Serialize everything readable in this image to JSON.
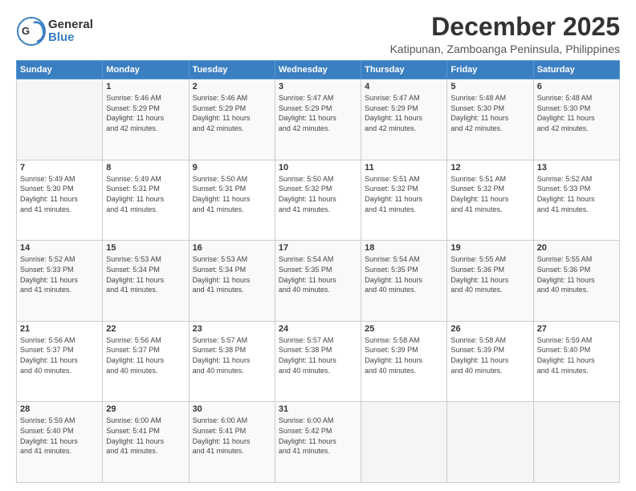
{
  "header": {
    "logo_general": "General",
    "logo_blue": "Blue",
    "title": "December 2025",
    "subtitle": "Katipunan, Zamboanga Peninsula, Philippines"
  },
  "days_of_week": [
    "Sunday",
    "Monday",
    "Tuesday",
    "Wednesday",
    "Thursday",
    "Friday",
    "Saturday"
  ],
  "weeks": [
    [
      {
        "day": "",
        "info": ""
      },
      {
        "day": "1",
        "info": "Sunrise: 5:46 AM\nSunset: 5:29 PM\nDaylight: 11 hours\nand 42 minutes."
      },
      {
        "day": "2",
        "info": "Sunrise: 5:46 AM\nSunset: 5:29 PM\nDaylight: 11 hours\nand 42 minutes."
      },
      {
        "day": "3",
        "info": "Sunrise: 5:47 AM\nSunset: 5:29 PM\nDaylight: 11 hours\nand 42 minutes."
      },
      {
        "day": "4",
        "info": "Sunrise: 5:47 AM\nSunset: 5:29 PM\nDaylight: 11 hours\nand 42 minutes."
      },
      {
        "day": "5",
        "info": "Sunrise: 5:48 AM\nSunset: 5:30 PM\nDaylight: 11 hours\nand 42 minutes."
      },
      {
        "day": "6",
        "info": "Sunrise: 5:48 AM\nSunset: 5:30 PM\nDaylight: 11 hours\nand 42 minutes."
      }
    ],
    [
      {
        "day": "7",
        "info": "Sunrise: 5:49 AM\nSunset: 5:30 PM\nDaylight: 11 hours\nand 41 minutes."
      },
      {
        "day": "8",
        "info": "Sunrise: 5:49 AM\nSunset: 5:31 PM\nDaylight: 11 hours\nand 41 minutes."
      },
      {
        "day": "9",
        "info": "Sunrise: 5:50 AM\nSunset: 5:31 PM\nDaylight: 11 hours\nand 41 minutes."
      },
      {
        "day": "10",
        "info": "Sunrise: 5:50 AM\nSunset: 5:32 PM\nDaylight: 11 hours\nand 41 minutes."
      },
      {
        "day": "11",
        "info": "Sunrise: 5:51 AM\nSunset: 5:32 PM\nDaylight: 11 hours\nand 41 minutes."
      },
      {
        "day": "12",
        "info": "Sunrise: 5:51 AM\nSunset: 5:32 PM\nDaylight: 11 hours\nand 41 minutes."
      },
      {
        "day": "13",
        "info": "Sunrise: 5:52 AM\nSunset: 5:33 PM\nDaylight: 11 hours\nand 41 minutes."
      }
    ],
    [
      {
        "day": "14",
        "info": "Sunrise: 5:52 AM\nSunset: 5:33 PM\nDaylight: 11 hours\nand 41 minutes."
      },
      {
        "day": "15",
        "info": "Sunrise: 5:53 AM\nSunset: 5:34 PM\nDaylight: 11 hours\nand 41 minutes."
      },
      {
        "day": "16",
        "info": "Sunrise: 5:53 AM\nSunset: 5:34 PM\nDaylight: 11 hours\nand 41 minutes."
      },
      {
        "day": "17",
        "info": "Sunrise: 5:54 AM\nSunset: 5:35 PM\nDaylight: 11 hours\nand 40 minutes."
      },
      {
        "day": "18",
        "info": "Sunrise: 5:54 AM\nSunset: 5:35 PM\nDaylight: 11 hours\nand 40 minutes."
      },
      {
        "day": "19",
        "info": "Sunrise: 5:55 AM\nSunset: 5:36 PM\nDaylight: 11 hours\nand 40 minutes."
      },
      {
        "day": "20",
        "info": "Sunrise: 5:55 AM\nSunset: 5:36 PM\nDaylight: 11 hours\nand 40 minutes."
      }
    ],
    [
      {
        "day": "21",
        "info": "Sunrise: 5:56 AM\nSunset: 5:37 PM\nDaylight: 11 hours\nand 40 minutes."
      },
      {
        "day": "22",
        "info": "Sunrise: 5:56 AM\nSunset: 5:37 PM\nDaylight: 11 hours\nand 40 minutes."
      },
      {
        "day": "23",
        "info": "Sunrise: 5:57 AM\nSunset: 5:38 PM\nDaylight: 11 hours\nand 40 minutes."
      },
      {
        "day": "24",
        "info": "Sunrise: 5:57 AM\nSunset: 5:38 PM\nDaylight: 11 hours\nand 40 minutes."
      },
      {
        "day": "25",
        "info": "Sunrise: 5:58 AM\nSunset: 5:39 PM\nDaylight: 11 hours\nand 40 minutes."
      },
      {
        "day": "26",
        "info": "Sunrise: 5:58 AM\nSunset: 5:39 PM\nDaylight: 11 hours\nand 40 minutes."
      },
      {
        "day": "27",
        "info": "Sunrise: 5:59 AM\nSunset: 5:40 PM\nDaylight: 11 hours\nand 41 minutes."
      }
    ],
    [
      {
        "day": "28",
        "info": "Sunrise: 5:59 AM\nSunset: 5:40 PM\nDaylight: 11 hours\nand 41 minutes."
      },
      {
        "day": "29",
        "info": "Sunrise: 6:00 AM\nSunset: 5:41 PM\nDaylight: 11 hours\nand 41 minutes."
      },
      {
        "day": "30",
        "info": "Sunrise: 6:00 AM\nSunset: 5:41 PM\nDaylight: 11 hours\nand 41 minutes."
      },
      {
        "day": "31",
        "info": "Sunrise: 6:00 AM\nSunset: 5:42 PM\nDaylight: 11 hours\nand 41 minutes."
      },
      {
        "day": "",
        "info": ""
      },
      {
        "day": "",
        "info": ""
      },
      {
        "day": "",
        "info": ""
      }
    ]
  ]
}
